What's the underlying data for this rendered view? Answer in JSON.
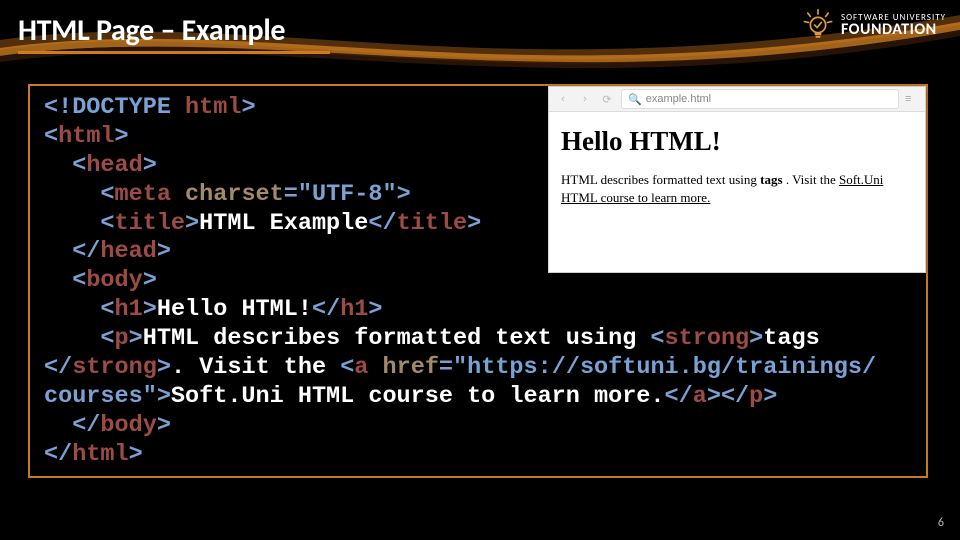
{
  "slide": {
    "title": "HTML Page – Example",
    "number": "6"
  },
  "logo": {
    "line1": "SOFTWARE UNIVERSITY",
    "line2": "FOUNDATION"
  },
  "code": {
    "l1_a": "<!DOCTYPE",
    "l1_b": " html",
    "l1_c": ">",
    "l2_a": "<",
    "l2_b": "html",
    "l2_c": ">",
    "l3_a": "  <",
    "l3_b": "head",
    "l3_c": ">",
    "l4_a": "    <",
    "l4_b": "meta",
    "l4_c": " charset",
    "l4_d": "=\"UTF-8\">",
    "l5_a": "    <",
    "l5_b": "title",
    "l5_c": ">",
    "l5_d": "HTML Example",
    "l5_e": "</",
    "l5_f": "title",
    "l5_g": ">",
    "l6_a": "  </",
    "l6_b": "head",
    "l6_c": ">",
    "l7_a": "  <",
    "l7_b": "body",
    "l7_c": ">",
    "l8_a": "    <",
    "l8_b": "h1",
    "l8_c": ">",
    "l8_d": "Hello HTML!",
    "l8_e": "</",
    "l8_f": "h1",
    "l8_g": ">",
    "l9_a": "    <",
    "l9_b": "p",
    "l9_c": ">",
    "l9_d": "HTML describes formatted text using ",
    "l9_e": "<",
    "l9_f": "strong",
    "l9_g": ">",
    "l9_h": "tags",
    "l10_a": "</",
    "l10_b": "strong",
    "l10_c": ">",
    "l10_d": ". Visit the ",
    "l10_e": "<",
    "l10_f": "a",
    "l10_g": " href",
    "l10_h": "=\"https://softuni.bg/trainings/",
    "l11_a": "courses\">",
    "l11_b": "Soft.Uni HTML course to learn more.",
    "l11_c": "</",
    "l11_d": "a",
    "l11_e": "></",
    "l11_f": "p",
    "l11_g": ">",
    "l12_a": "  </",
    "l12_b": "body",
    "l12_c": ">",
    "l13_a": "</",
    "l13_b": "html",
    "l13_c": ">"
  },
  "browser": {
    "address": "example.html",
    "heading": "Hello HTML!",
    "para_a": "HTML describes formatted text using ",
    "para_strong": "tags",
    "para_b": " . Visit the ",
    "para_link": "Soft.Uni HTML course to learn more.",
    "nav_back": "‹",
    "nav_fwd": "›",
    "nav_reload": "⟳",
    "nav_menu": "≡",
    "mag": "🔍"
  }
}
